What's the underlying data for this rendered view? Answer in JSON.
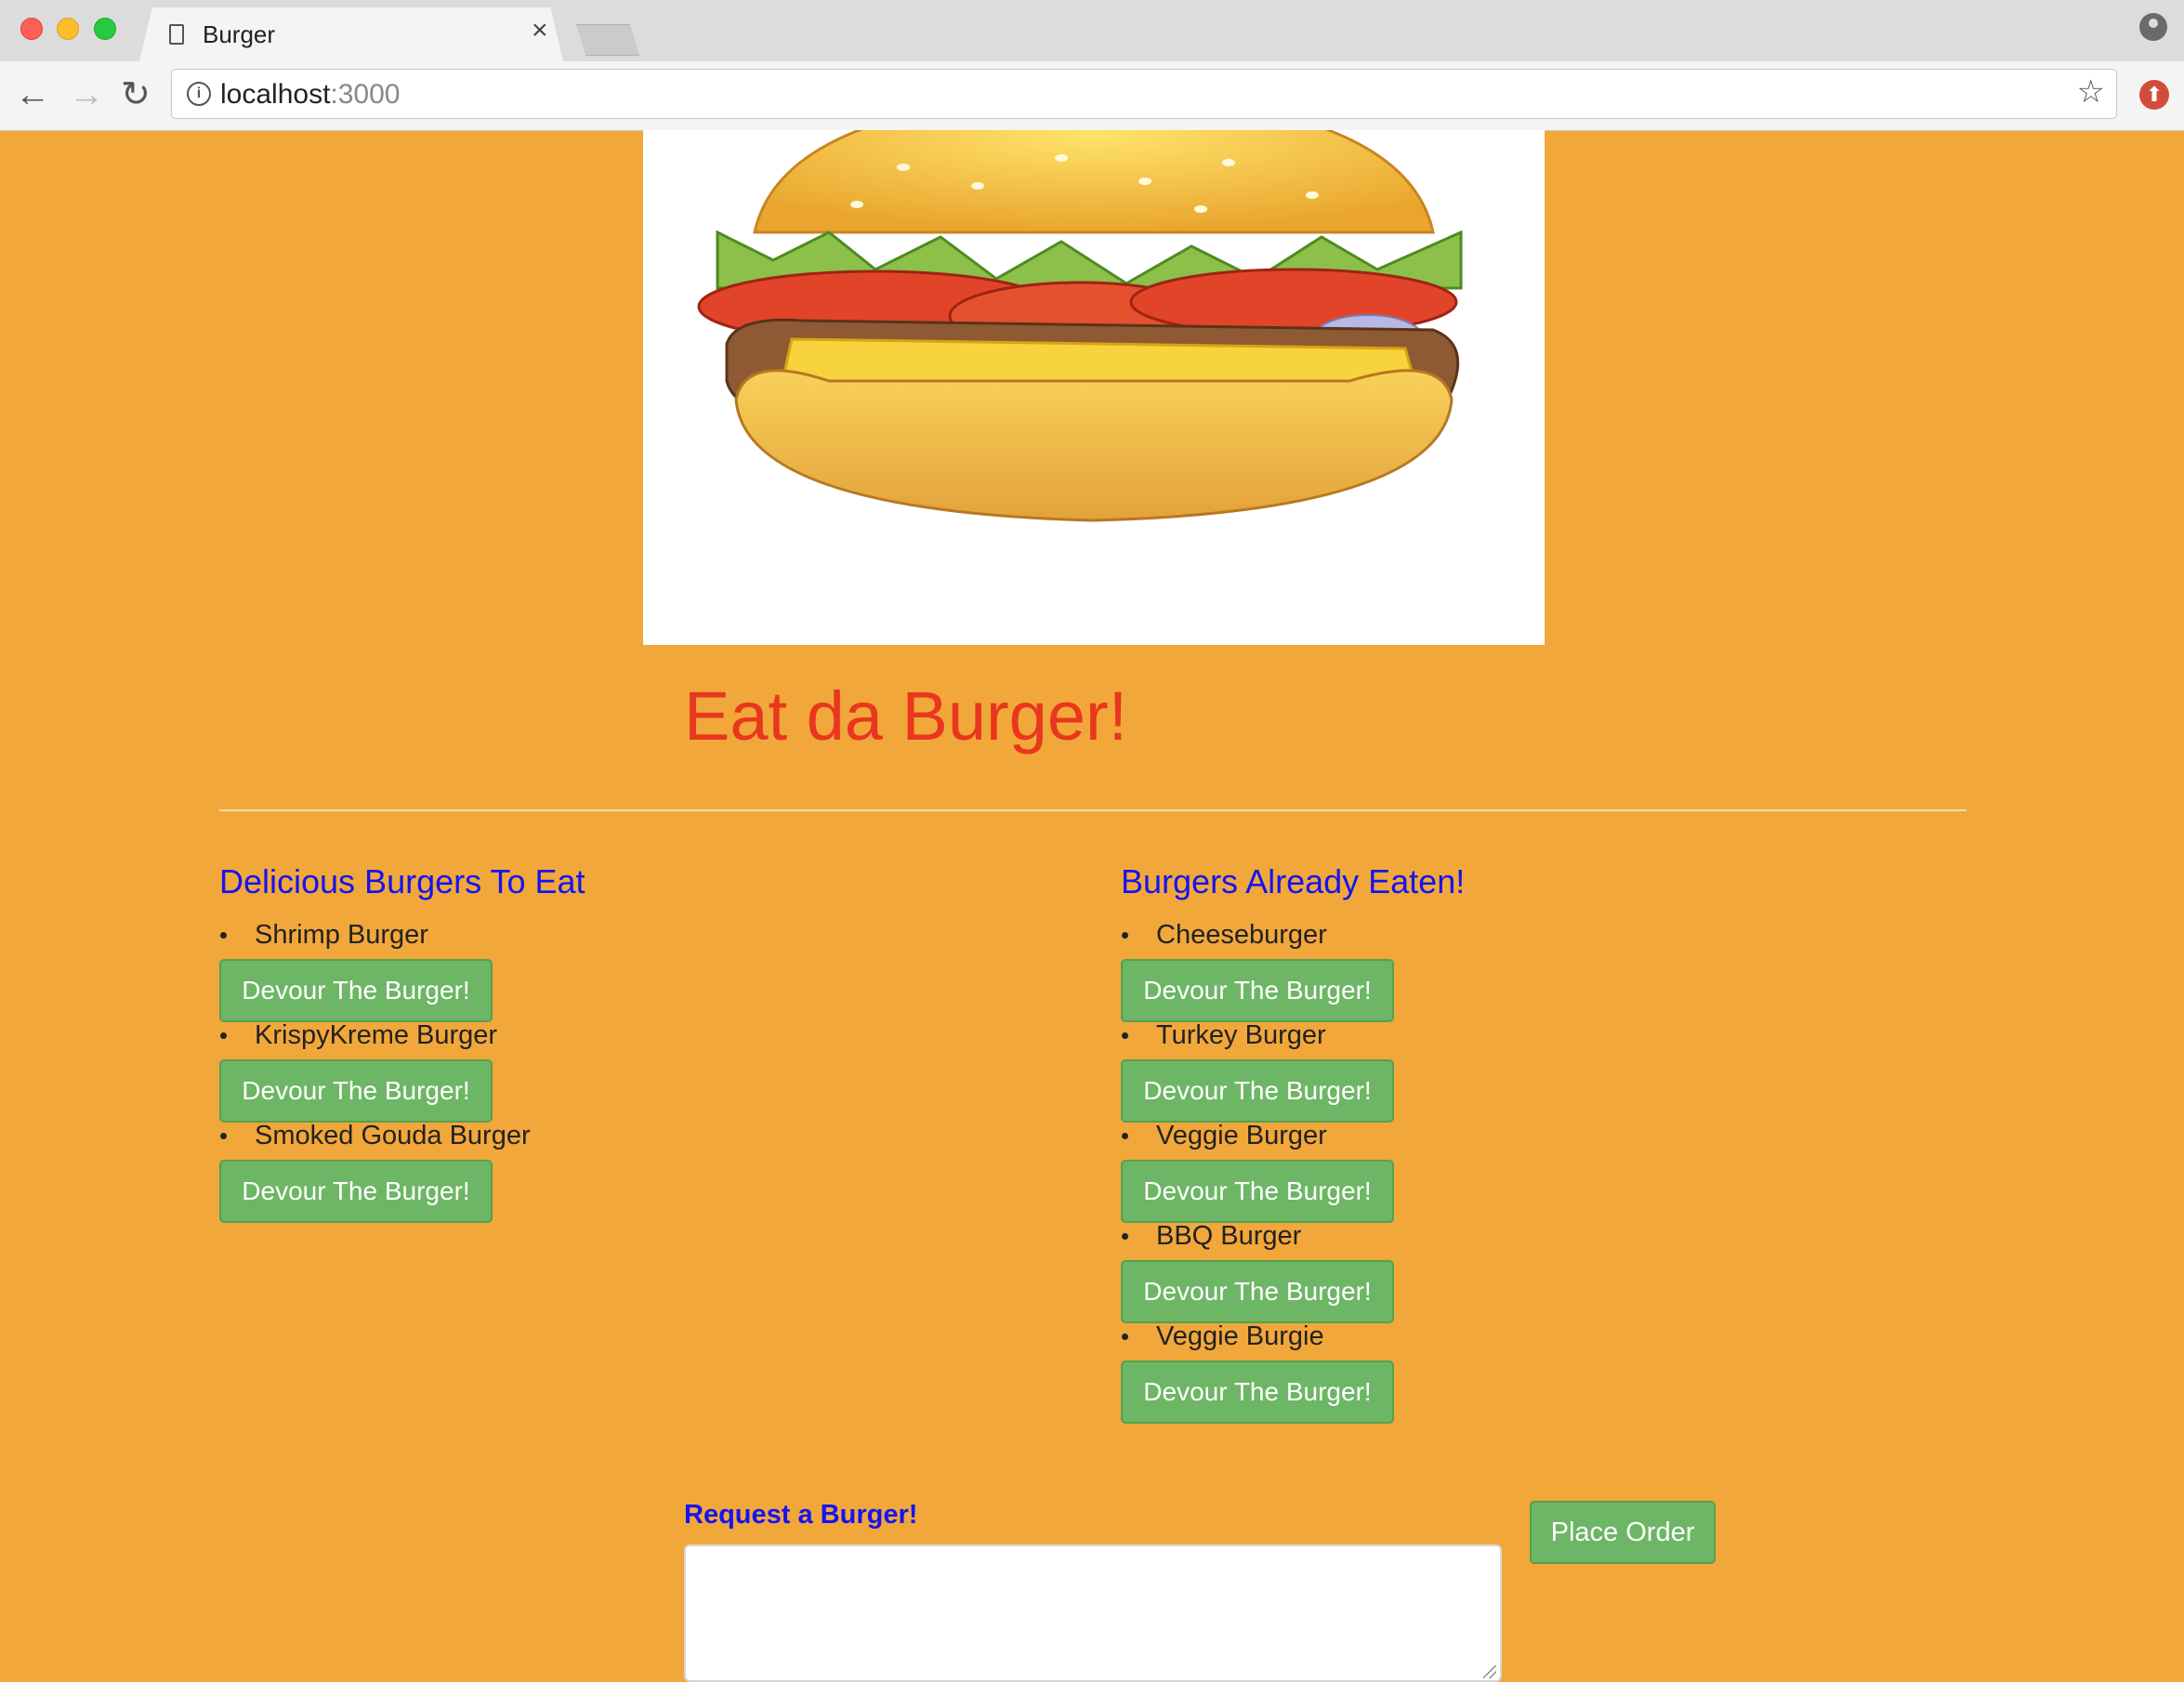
{
  "browser": {
    "tab_title": "Burger",
    "url_host": "localhost",
    "url_port": ":3000"
  },
  "page": {
    "title": "Eat da Burger!",
    "to_eat_heading": "Delicious Burgers To Eat",
    "eaten_heading": "Burgers Already Eaten!",
    "button_label": "Devour The Burger!",
    "to_eat": [
      "Shrimp Burger",
      "KrispyKreme Burger",
      "Smoked Gouda Burger"
    ],
    "eaten": [
      "Cheeseburger",
      "Turkey Burger",
      "Veggie Burger",
      "BBQ Burger",
      "Veggie Burgie"
    ],
    "request_label": "Request a Burger!",
    "request_value": "",
    "order_button": "Place Order"
  },
  "colors": {
    "background": "#f2a73b",
    "title": "#e8371e",
    "headings": "#1414f0",
    "button": "#6db665"
  }
}
